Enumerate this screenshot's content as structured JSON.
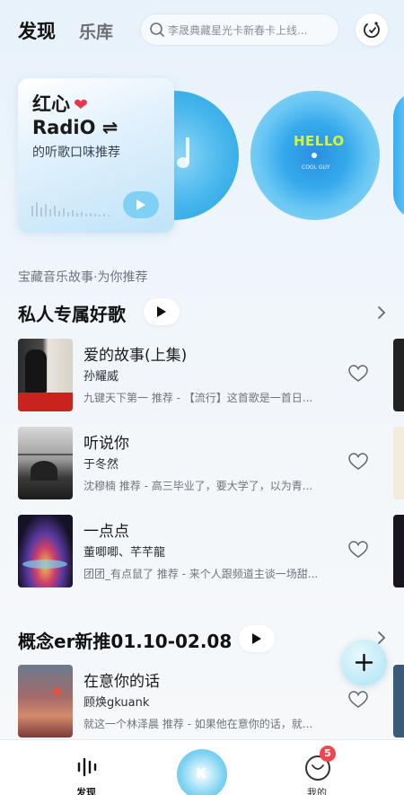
{
  "header": {
    "tab_discover": "发现",
    "tab_library": "乐库",
    "search_placeholder": "李晟典藏星光卡新春卡上线..."
  },
  "radio_card": {
    "title_line1": "红心",
    "title_line2": "RadiO ⇌",
    "subtitle": "的听歌口味推荐"
  },
  "discs": [
    {
      "label": "",
      "icon": "music-note-icon"
    },
    {
      "label": "HELLO",
      "sublabel": "COOL GUY"
    },
    {
      "label": ""
    }
  ],
  "caption": "宝藏音乐故事·为你推荐",
  "section1": {
    "title": "私人专属好歌",
    "songs": [
      {
        "title": "爱的故事(上集)",
        "artist": "孙耀威",
        "desc": "九键天下第一 推荐 - 【流行】这首歌是一首日..."
      },
      {
        "title": "听说你",
        "artist": "于冬然",
        "desc": "沈穆楠 推荐 - 高三毕业了，要大学了，以为青..."
      },
      {
        "title": "一点点",
        "artist": "董唧唧、芊芊龍",
        "desc": "团团_有点鼠了 推荐 - 来个人跟频道主谈一场甜..."
      }
    ]
  },
  "section2": {
    "title": "概念er新推01.10-02.08",
    "songs": [
      {
        "title": "在意你的话",
        "artist": "顾焕gkuank",
        "desc": "就这一个林泽晨 推荐 - 如果他在意你的话，就..."
      }
    ]
  },
  "bottom_nav": {
    "discover_label": "发现",
    "center_label": "K",
    "me_label": "我的",
    "me_badge": "5"
  }
}
